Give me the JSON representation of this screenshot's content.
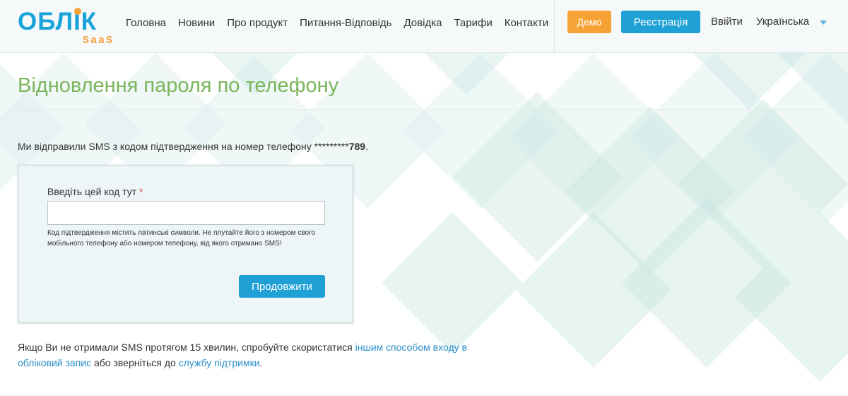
{
  "brand": {
    "logo_main": "ОБЛIК",
    "logo_sub": "SaaS"
  },
  "nav": {
    "items": [
      {
        "label": "Головна"
      },
      {
        "label": "Новини"
      },
      {
        "label": "Про продукт"
      },
      {
        "label": "Питання-Відповідь"
      },
      {
        "label": "Довідка"
      },
      {
        "label": "Тарифи"
      },
      {
        "label": "Контакти"
      }
    ]
  },
  "header_actions": {
    "demo_label": "Демо",
    "register_label": "Реєстрація",
    "login_label": "Ввійти",
    "language_label": "Українська"
  },
  "page": {
    "title": "Відновлення пароля по телефону",
    "sms_note_prefix": "Ми відправили SMS з кодом підтвердження на номер телефону *********",
    "sms_note_phone": "789",
    "sms_note_suffix": "."
  },
  "form": {
    "code_label": "Введіть цей код тут",
    "required_mark": "*",
    "code_value": "",
    "code_hint": "Код підтвердження містить латинські символи. Не плутайте його з номером свого мобільного телефону або номером телефону, від якого отримано SMS!",
    "continue_label": "Продовжити"
  },
  "help": {
    "text_before": "Якщо Ви не отримали SMS протягом 15 хвилин, спробуйте скористатися ",
    "link_other_login": "іншим способом входу в обліковий запис",
    "text_middle": " або зверніться до ",
    "link_support": "службу підтримки",
    "text_after": "."
  },
  "colors": {
    "brand_blue": "#1fa1d6",
    "accent_orange": "#f7a234",
    "title_green": "#7ab55c",
    "link_blue": "#2a8fc7",
    "required_red": "#d9534f"
  }
}
